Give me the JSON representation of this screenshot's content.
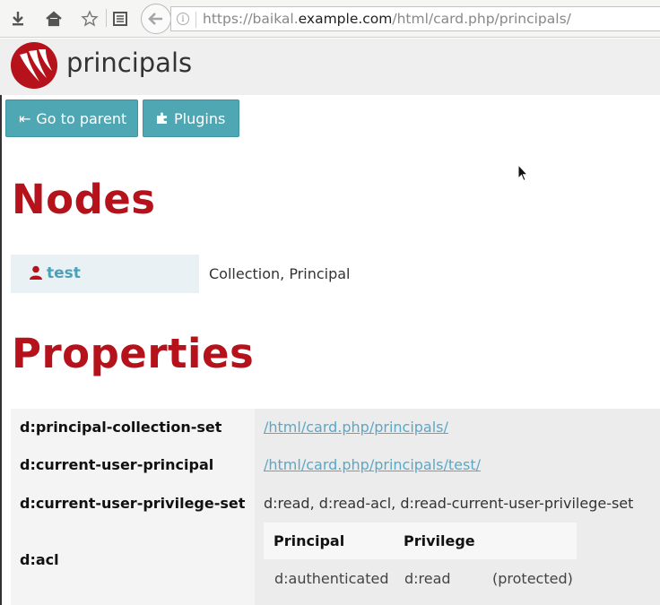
{
  "browser": {
    "url_prefix": "https://baikal.",
    "url_domain": "example.com",
    "url_path": "/html/card.php/principals/",
    "icons": [
      "download-icon",
      "home-icon",
      "bookmark-star-icon",
      "reader-icon",
      "back-arrow-icon",
      "info-icon"
    ]
  },
  "header": {
    "title": "principals",
    "logo_color": "#b5121b"
  },
  "actions": {
    "parent_icon": "⇤",
    "parent_label": "Go to parent",
    "plugins_label": "Plugins"
  },
  "nodes": {
    "heading": "Nodes",
    "items": [
      {
        "name": "test",
        "types": "Collection, Principal",
        "icon": "user-icon"
      }
    ]
  },
  "properties": {
    "heading": "Properties",
    "rows": [
      {
        "name": "d:principal-collection-set",
        "value": "/html/card.php/principals/"
      },
      {
        "name": "d:current-user-principal",
        "value": "/html/card.php/principals/test/"
      },
      {
        "name": "d:current-user-privilege-set",
        "value": "d:read, d:read-acl, d:read-current-user-privilege-set"
      },
      {
        "name": "d:acl"
      }
    ],
    "acl": {
      "headers": [
        "Principal",
        "Privilege"
      ],
      "rows": [
        {
          "principal": "d:authenticated",
          "privilege": "d:read",
          "note": "(protected)"
        }
      ]
    }
  },
  "colors": {
    "accent": "#b5121b",
    "button": "#4fa7b3",
    "link": "#4aa1b8"
  }
}
